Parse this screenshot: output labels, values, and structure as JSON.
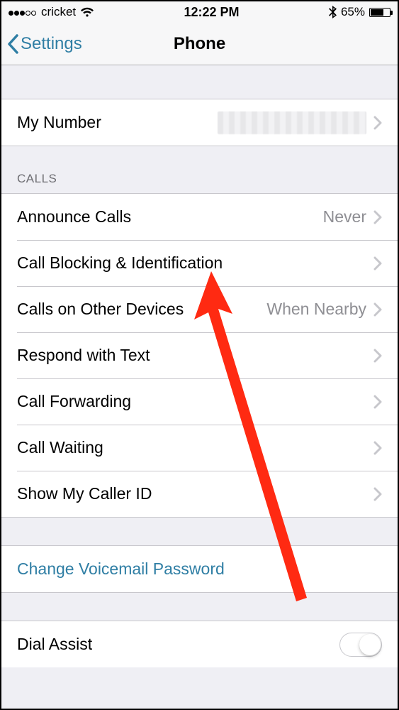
{
  "statusbar": {
    "carrier": "cricket",
    "time": "12:22 PM",
    "battery_pct": "65%"
  },
  "navbar": {
    "back_label": "Settings",
    "title": "Phone"
  },
  "rows": {
    "my_number": {
      "label": "My Number"
    },
    "calls_header": "CALLS",
    "announce_calls": {
      "label": "Announce Calls",
      "value": "Never"
    },
    "call_blocking": {
      "label": "Call Blocking & Identification"
    },
    "other_devices": {
      "label": "Calls on Other Devices",
      "value": "When Nearby"
    },
    "respond_text": {
      "label": "Respond with Text"
    },
    "call_forwarding": {
      "label": "Call Forwarding"
    },
    "call_waiting": {
      "label": "Call Waiting"
    },
    "caller_id": {
      "label": "Show My Caller ID"
    },
    "change_voicemail": {
      "label": "Change Voicemail Password"
    },
    "dial_assist": {
      "label": "Dial Assist"
    }
  }
}
